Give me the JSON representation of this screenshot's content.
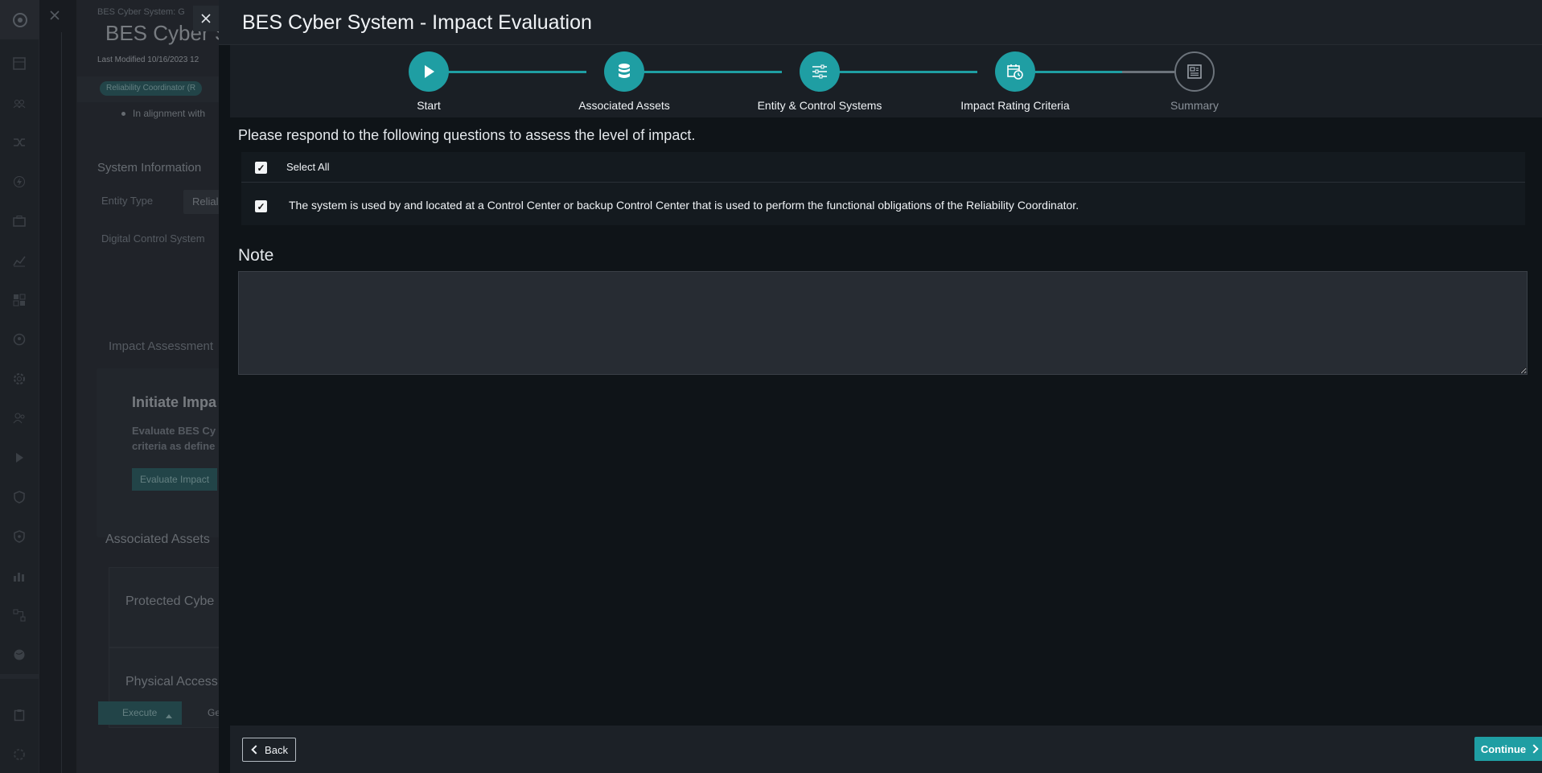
{
  "background": {
    "breadcrumb": "BES Cyber System: G",
    "title": "BES Cyber S",
    "last_modified": "Last Modified 10/16/2023 12",
    "tag": "Reliability Coordinator (R",
    "bullet": "In alignment with",
    "section_system_info": "System Information",
    "entity_type_label": "Entity Type",
    "entity_type_value": "Relial",
    "digital_control_label": "Digital Control System",
    "impact_assessment_label": "Impact Assessment",
    "card_title": "Initiate Impa",
    "card_text_1": "Evaluate BES Cy",
    "card_text_2": "criteria as define",
    "card_button": "Evaluate Impact",
    "associated_assets": "Associated Assets",
    "protected_box": "Protected Cybe",
    "physical_box": "Physical Access",
    "execute_button": "Execute",
    "chart_button": "Ge"
  },
  "nav_icons": [
    "logo-icon",
    "dashboard-icon",
    "users-icon",
    "shuffle-icon",
    "bolt-icon",
    "briefcase-icon",
    "chart-icon",
    "grid-icon",
    "shield-user-icon",
    "gear-icon",
    "people-icon",
    "play-icon",
    "shield-check-icon",
    "shield-lock-icon",
    "bar-chart-icon",
    "workflow-icon",
    "globe-icon",
    "clipboard-icon",
    "settings-icon"
  ],
  "modal": {
    "title": "BES Cyber System - Impact Evaluation",
    "steps": [
      {
        "label": "Start",
        "icon": "play-icon",
        "status": "complete"
      },
      {
        "label": "Associated Assets",
        "icon": "database-icon",
        "status": "complete"
      },
      {
        "label": "Entity & Control Systems",
        "icon": "sliders-icon",
        "status": "complete"
      },
      {
        "label": "Impact Rating Criteria",
        "icon": "calendar-clock-icon",
        "status": "active"
      },
      {
        "label": "Summary",
        "icon": "document-icon",
        "status": "pending"
      }
    ],
    "instruction": "Please respond to the following questions to assess the level of impact.",
    "select_all_label": "Select All",
    "select_all_checked": true,
    "questions": [
      {
        "text": "The system is used by and located at a Control Center or backup Control Center that is used to perform the functional obligations of the Reliability Coordinator.",
        "checked": true
      }
    ],
    "note_label": "Note",
    "note_value": "",
    "back_label": "Back",
    "continue_label": "Continue"
  },
  "colors": {
    "accent": "#1f9ea3",
    "modal_bg": "#0f1418",
    "header_bg": "#1c2127",
    "pending": "#6c737b"
  }
}
